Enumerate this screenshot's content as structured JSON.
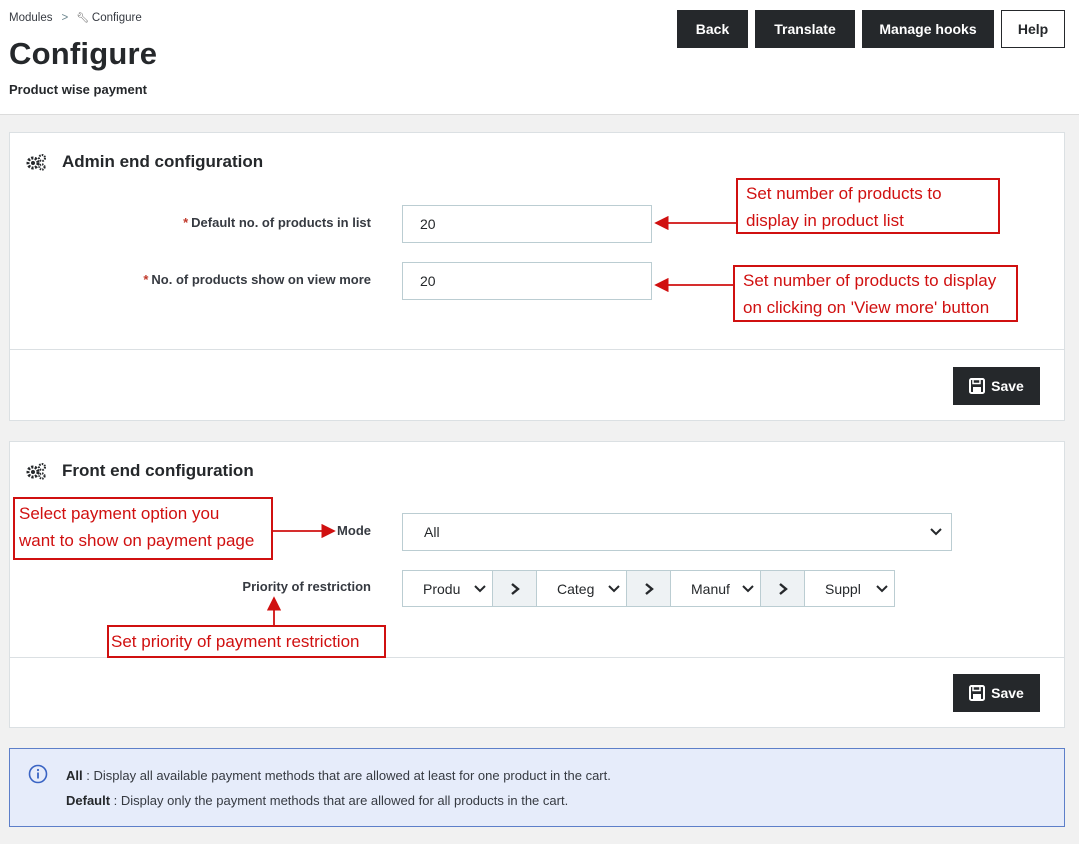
{
  "breadcrumb": {
    "parent": "Modules",
    "separator": ">",
    "current": "Configure"
  },
  "page": {
    "title": "Configure",
    "subtitle": "Product wise payment"
  },
  "toolbar": {
    "back": "Back",
    "translate": "Translate",
    "manage_hooks": "Manage hooks",
    "help": "Help"
  },
  "admin_panel": {
    "title": "Admin end configuration",
    "fields": [
      {
        "required": "*",
        "label": "Default no. of products in list",
        "value": "20"
      },
      {
        "required": "*",
        "label": "No. of products show on view more",
        "value": "20"
      }
    ],
    "save": "Save"
  },
  "front_panel": {
    "title": "Front end configuration",
    "mode_label": "Mode",
    "mode_value": "All",
    "priority_label": "Priority of restriction",
    "priority_options": [
      "Produ",
      "Categ",
      "Manuf",
      "Suppl"
    ],
    "save": "Save"
  },
  "info": {
    "all_term": "All",
    "all_text": " : Display all available payment methods that are allowed at least for one product in the cart.",
    "default_term": "Default",
    "default_text": " : Display only the payment methods that are allowed for all products in the cart."
  },
  "annotations": {
    "products_list": [
      "Set number of products to",
      "display in product list"
    ],
    "view_more": [
      "Set number of products to display",
      "on clicking on 'View more' button"
    ],
    "payment_option": [
      "Select payment option you",
      "want to show on payment page"
    ],
    "priority": "Set priority of payment restriction"
  },
  "colors": {
    "accent_dark": "#25282b",
    "annotation_red": "#d01010",
    "info_bg": "#e6ecfa",
    "info_border": "#5d7fc9"
  },
  "icons": {
    "settings": "gears-icon",
    "save": "floppy-disk-icon",
    "info": "info-circle-icon",
    "next": "chevron-right-icon",
    "dropdown": "chevron-down-icon",
    "configure": "wrench-icon"
  }
}
